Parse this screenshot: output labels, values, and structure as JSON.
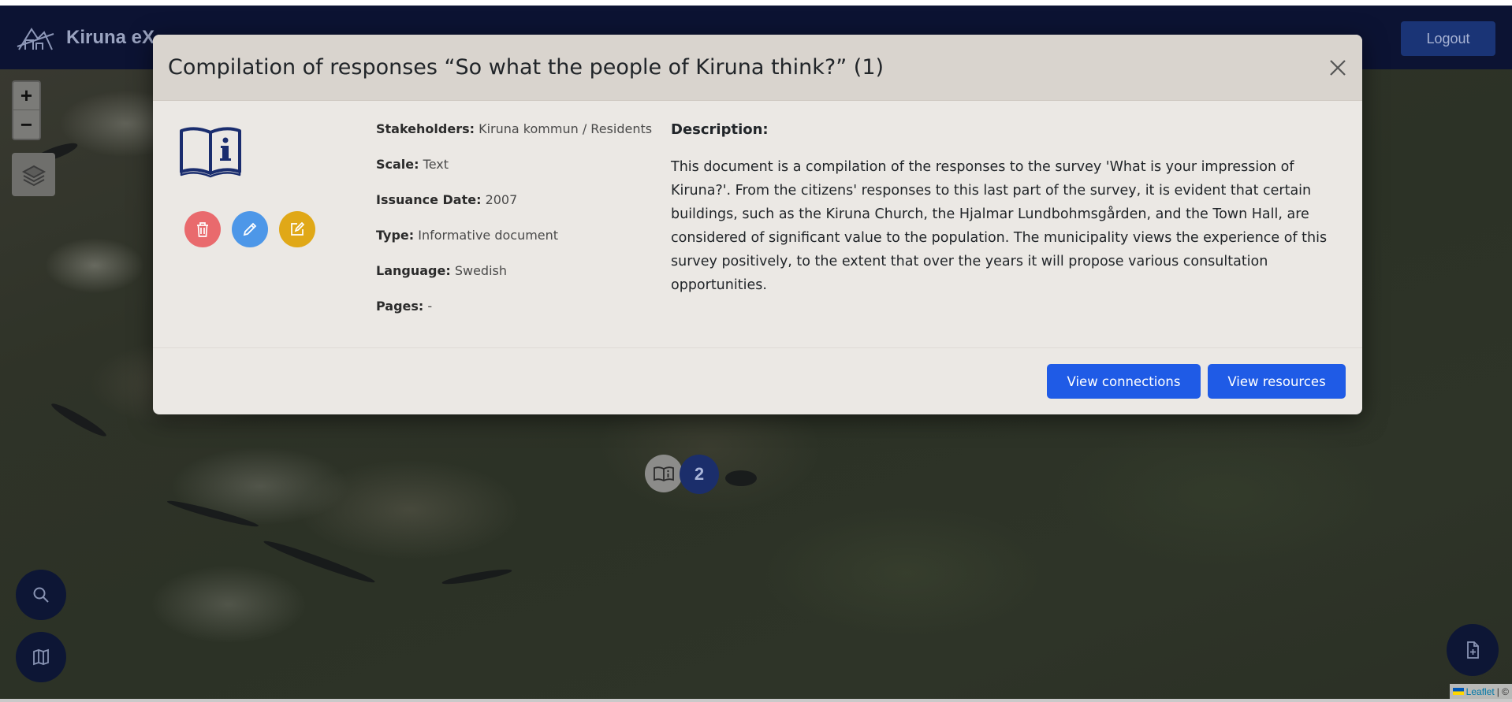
{
  "navbar": {
    "app_title": "Kiruna eX",
    "logo_icon": "kiruna-logo-icon",
    "logout_label": "Logout"
  },
  "map_controls": {
    "zoom_in_label": "+",
    "zoom_out_label": "−",
    "layers_icon": "layers-icon",
    "search_icon": "search-icon",
    "map_icon": "map-icon",
    "add_document_icon": "file-plus-icon"
  },
  "cluster": {
    "doc_icon": "book-info-icon",
    "count": "2"
  },
  "attribution": {
    "leaflet_label": "Leaflet",
    "separator": "| ©"
  },
  "modal": {
    "title": "Compilation of responses “So what the people of Kiruna think?” (1)",
    "close_icon": "close-icon",
    "doc_icon": "book-info-icon",
    "actions": {
      "delete_icon": "trash-icon",
      "edit_icon": "pencil-icon",
      "link_icon": "edit-square-icon"
    },
    "meta": [
      {
        "key": "Stakeholders:",
        "value": "Kiruna kommun / Residents"
      },
      {
        "key": "Scale:",
        "value": "Text"
      },
      {
        "key": "Issuance Date:",
        "value": "2007"
      },
      {
        "key": "Type:",
        "value": "Informative document"
      },
      {
        "key": "Language:",
        "value": "Swedish"
      },
      {
        "key": "Pages:",
        "value": "-"
      }
    ],
    "description_title": "Description:",
    "description_text": "This document is a compilation of the responses to the survey 'What is your impression of Kiruna?'. From the citizens' responses to this last part of the survey, it is evident that certain buildings, such as the Kiruna Church, the Hjalmar Lundbohmsgården, and the Town Hall, are considered of significant value to the population. The municipality views the experience of this survey positively, to the extent that over the years it will propose various consultation opportunities.",
    "view_connections_label": "View connections",
    "view_resources_label": "View resources"
  },
  "colors": {
    "navbar": "#0c1333",
    "primary_button": "#1f5be6",
    "delete": "#e96a6d",
    "edit": "#4d97e8",
    "link": "#e0a817",
    "icon_navy": "#1a2d6e"
  }
}
